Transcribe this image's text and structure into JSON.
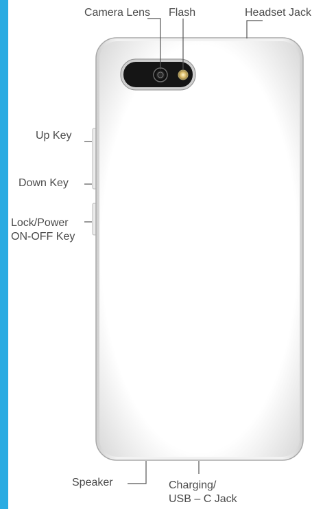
{
  "labels": {
    "camera_lens": "Camera Lens",
    "flash": "Flash",
    "headset_jack": "Headset Jack",
    "up_key": "Up Key",
    "down_key": "Down Key",
    "lock_power_line1": "Lock/Power",
    "lock_power_line2": "ON-OFF Key",
    "speaker": "Speaker",
    "charging_line1": "Charging/",
    "charging_line2": "USB – C Jack"
  },
  "colors": {
    "accent_bar": "#29abe2",
    "phone_body": "#f4f4f4",
    "phone_edge": "#bdbdbd",
    "label_text": "#4a4a4a",
    "leader_line": "#555555"
  }
}
